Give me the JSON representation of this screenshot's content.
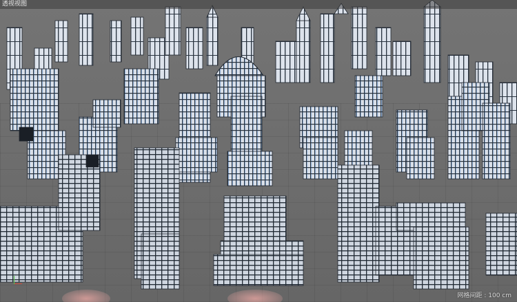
{
  "viewport": {
    "title": "透视视图",
    "status_label": "网格间距 : 100 cm"
  },
  "scene": {
    "description_icon": "3d-city-wireframe",
    "colors": {
      "background": "#6e6e6e",
      "face": "#d9dfe8",
      "edge": "#2a2f38",
      "highlight": "#5aa0e8"
    }
  }
}
